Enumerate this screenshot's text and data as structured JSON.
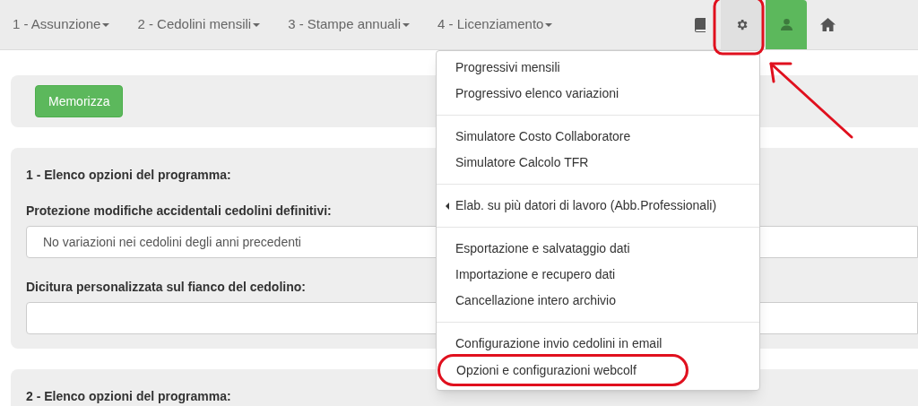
{
  "navbar": {
    "menus": [
      {
        "label": "1 - Assunzione"
      },
      {
        "label": "2 - Cedolini mensili"
      },
      {
        "label": "3 - Stampe annuali"
      },
      {
        "label": "4 - Licenziamento"
      }
    ],
    "tools": [
      {
        "kind": "book",
        "selected": false
      },
      {
        "kind": "gear",
        "selected": true
      },
      {
        "kind": "user",
        "selected": false
      },
      {
        "kind": "home",
        "selected": false
      }
    ]
  },
  "save_button": "Memorizza",
  "sections": [
    {
      "title": "1 - Elenco opzioni del programma:",
      "fields": [
        {
          "label": "Protezione modifiche accidentali cedolini definitivi:",
          "value": "No variazioni nei cedolini degli anni precedenti"
        },
        {
          "label": "Dicitura personalizzata sul fianco del cedolino:"
        }
      ]
    },
    {
      "title": "2 - Elenco opzioni del programma:"
    }
  ],
  "dropdown": {
    "groups": [
      {
        "items": [
          {
            "label": "Progressivi mensili",
            "submenu": false
          },
          {
            "label": "Progressivo elenco variazioni",
            "submenu": false
          }
        ]
      },
      {
        "items": [
          {
            "label": "Simulatore Costo Collaboratore",
            "submenu": false
          },
          {
            "label": "Simulatore Calcolo TFR",
            "submenu": false
          }
        ]
      },
      {
        "items": [
          {
            "label": "Elab. su più datori di lavoro (Abb.Professionali)",
            "submenu": true
          }
        ]
      },
      {
        "items": [
          {
            "label": "Esportazione e salvataggio dati",
            "submenu": false
          },
          {
            "label": "Importazione e recupero dati",
            "submenu": false
          },
          {
            "label": "Cancellazione intero archivio",
            "submenu": false
          }
        ]
      },
      {
        "items": [
          {
            "label": "Configurazione invio cedolini in email",
            "submenu": false
          },
          {
            "label": "Opzioni e configurazioni webcolf",
            "submenu": false,
            "highlighted": true
          }
        ]
      }
    ]
  }
}
